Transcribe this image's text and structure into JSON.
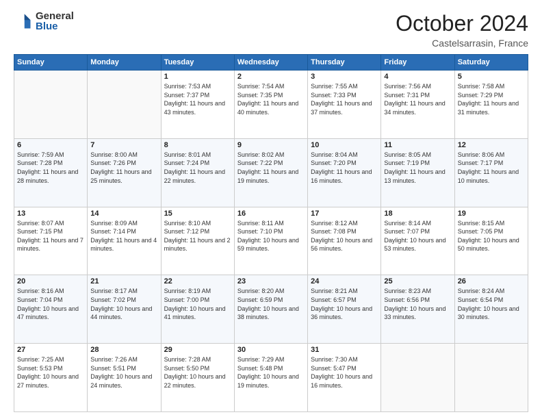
{
  "logo": {
    "general": "General",
    "blue": "Blue"
  },
  "header": {
    "month": "October 2024",
    "location": "Castelsarrasin, France"
  },
  "weekdays": [
    "Sunday",
    "Monday",
    "Tuesday",
    "Wednesday",
    "Thursday",
    "Friday",
    "Saturday"
  ],
  "weeks": [
    [
      {
        "day": "",
        "info": ""
      },
      {
        "day": "",
        "info": ""
      },
      {
        "day": "1",
        "info": "Sunrise: 7:53 AM\nSunset: 7:37 PM\nDaylight: 11 hours and 43 minutes."
      },
      {
        "day": "2",
        "info": "Sunrise: 7:54 AM\nSunset: 7:35 PM\nDaylight: 11 hours and 40 minutes."
      },
      {
        "day": "3",
        "info": "Sunrise: 7:55 AM\nSunset: 7:33 PM\nDaylight: 11 hours and 37 minutes."
      },
      {
        "day": "4",
        "info": "Sunrise: 7:56 AM\nSunset: 7:31 PM\nDaylight: 11 hours and 34 minutes."
      },
      {
        "day": "5",
        "info": "Sunrise: 7:58 AM\nSunset: 7:29 PM\nDaylight: 11 hours and 31 minutes."
      }
    ],
    [
      {
        "day": "6",
        "info": "Sunrise: 7:59 AM\nSunset: 7:28 PM\nDaylight: 11 hours and 28 minutes."
      },
      {
        "day": "7",
        "info": "Sunrise: 8:00 AM\nSunset: 7:26 PM\nDaylight: 11 hours and 25 minutes."
      },
      {
        "day": "8",
        "info": "Sunrise: 8:01 AM\nSunset: 7:24 PM\nDaylight: 11 hours and 22 minutes."
      },
      {
        "day": "9",
        "info": "Sunrise: 8:02 AM\nSunset: 7:22 PM\nDaylight: 11 hours and 19 minutes."
      },
      {
        "day": "10",
        "info": "Sunrise: 8:04 AM\nSunset: 7:20 PM\nDaylight: 11 hours and 16 minutes."
      },
      {
        "day": "11",
        "info": "Sunrise: 8:05 AM\nSunset: 7:19 PM\nDaylight: 11 hours and 13 minutes."
      },
      {
        "day": "12",
        "info": "Sunrise: 8:06 AM\nSunset: 7:17 PM\nDaylight: 11 hours and 10 minutes."
      }
    ],
    [
      {
        "day": "13",
        "info": "Sunrise: 8:07 AM\nSunset: 7:15 PM\nDaylight: 11 hours and 7 minutes."
      },
      {
        "day": "14",
        "info": "Sunrise: 8:09 AM\nSunset: 7:14 PM\nDaylight: 11 hours and 4 minutes."
      },
      {
        "day": "15",
        "info": "Sunrise: 8:10 AM\nSunset: 7:12 PM\nDaylight: 11 hours and 2 minutes."
      },
      {
        "day": "16",
        "info": "Sunrise: 8:11 AM\nSunset: 7:10 PM\nDaylight: 10 hours and 59 minutes."
      },
      {
        "day": "17",
        "info": "Sunrise: 8:12 AM\nSunset: 7:08 PM\nDaylight: 10 hours and 56 minutes."
      },
      {
        "day": "18",
        "info": "Sunrise: 8:14 AM\nSunset: 7:07 PM\nDaylight: 10 hours and 53 minutes."
      },
      {
        "day": "19",
        "info": "Sunrise: 8:15 AM\nSunset: 7:05 PM\nDaylight: 10 hours and 50 minutes."
      }
    ],
    [
      {
        "day": "20",
        "info": "Sunrise: 8:16 AM\nSunset: 7:04 PM\nDaylight: 10 hours and 47 minutes."
      },
      {
        "day": "21",
        "info": "Sunrise: 8:17 AM\nSunset: 7:02 PM\nDaylight: 10 hours and 44 minutes."
      },
      {
        "day": "22",
        "info": "Sunrise: 8:19 AM\nSunset: 7:00 PM\nDaylight: 10 hours and 41 minutes."
      },
      {
        "day": "23",
        "info": "Sunrise: 8:20 AM\nSunset: 6:59 PM\nDaylight: 10 hours and 38 minutes."
      },
      {
        "day": "24",
        "info": "Sunrise: 8:21 AM\nSunset: 6:57 PM\nDaylight: 10 hours and 36 minutes."
      },
      {
        "day": "25",
        "info": "Sunrise: 8:23 AM\nSunset: 6:56 PM\nDaylight: 10 hours and 33 minutes."
      },
      {
        "day": "26",
        "info": "Sunrise: 8:24 AM\nSunset: 6:54 PM\nDaylight: 10 hours and 30 minutes."
      }
    ],
    [
      {
        "day": "27",
        "info": "Sunrise: 7:25 AM\nSunset: 5:53 PM\nDaylight: 10 hours and 27 minutes."
      },
      {
        "day": "28",
        "info": "Sunrise: 7:26 AM\nSunset: 5:51 PM\nDaylight: 10 hours and 24 minutes."
      },
      {
        "day": "29",
        "info": "Sunrise: 7:28 AM\nSunset: 5:50 PM\nDaylight: 10 hours and 22 minutes."
      },
      {
        "day": "30",
        "info": "Sunrise: 7:29 AM\nSunset: 5:48 PM\nDaylight: 10 hours and 19 minutes."
      },
      {
        "day": "31",
        "info": "Sunrise: 7:30 AM\nSunset: 5:47 PM\nDaylight: 10 hours and 16 minutes."
      },
      {
        "day": "",
        "info": ""
      },
      {
        "day": "",
        "info": ""
      }
    ]
  ]
}
